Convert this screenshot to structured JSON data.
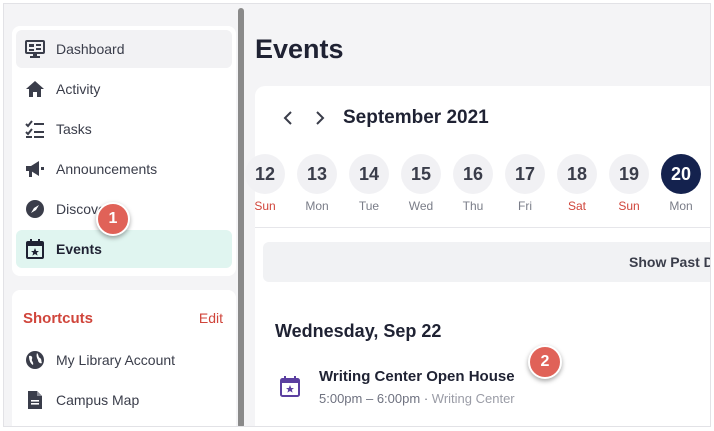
{
  "sidebar": {
    "items": [
      {
        "label": "Dashboard",
        "icon": "dashboard-icon"
      },
      {
        "label": "Activity",
        "icon": "home-icon"
      },
      {
        "label": "Tasks",
        "icon": "tasks-icon"
      },
      {
        "label": "Announcements",
        "icon": "megaphone-icon"
      },
      {
        "label": "Discover",
        "icon": "compass-icon"
      },
      {
        "label": "Events",
        "icon": "calendar-star-icon"
      }
    ],
    "shortcuts": {
      "title": "Shortcuts",
      "edit_label": "Edit",
      "items": [
        {
          "label": "My Library Account",
          "icon": "globe-icon"
        },
        {
          "label": "Campus Map",
          "icon": "document-icon"
        }
      ]
    }
  },
  "main": {
    "title": "Events",
    "calendar": {
      "month": "September 2021",
      "days": [
        {
          "num": "12",
          "dow": "Sun",
          "weekend": true
        },
        {
          "num": "13",
          "dow": "Mon",
          "weekend": false
        },
        {
          "num": "14",
          "dow": "Tue",
          "weekend": false
        },
        {
          "num": "15",
          "dow": "Wed",
          "weekend": false
        },
        {
          "num": "16",
          "dow": "Thu",
          "weekend": false
        },
        {
          "num": "17",
          "dow": "Fri",
          "weekend": false
        },
        {
          "num": "18",
          "dow": "Sat",
          "weekend": true
        },
        {
          "num": "19",
          "dow": "Sun",
          "weekend": true
        },
        {
          "num": "20",
          "dow": "Mon",
          "weekend": false,
          "selected": true
        }
      ],
      "show_past_label": "Show Past D"
    },
    "date_heading": "Wednesday, Sep 22",
    "event": {
      "title": "Writing Center Open House",
      "time": "5:00pm – 6:00pm",
      "separator": "·",
      "location": "Writing Center"
    }
  },
  "annotations": [
    "1",
    "2"
  ],
  "colors": {
    "accent_red": "#d0453b",
    "active_bg": "#e0f5f0",
    "selected_day": "#14224e",
    "event_icon": "#5b3fa0",
    "badge": "#e06258"
  }
}
